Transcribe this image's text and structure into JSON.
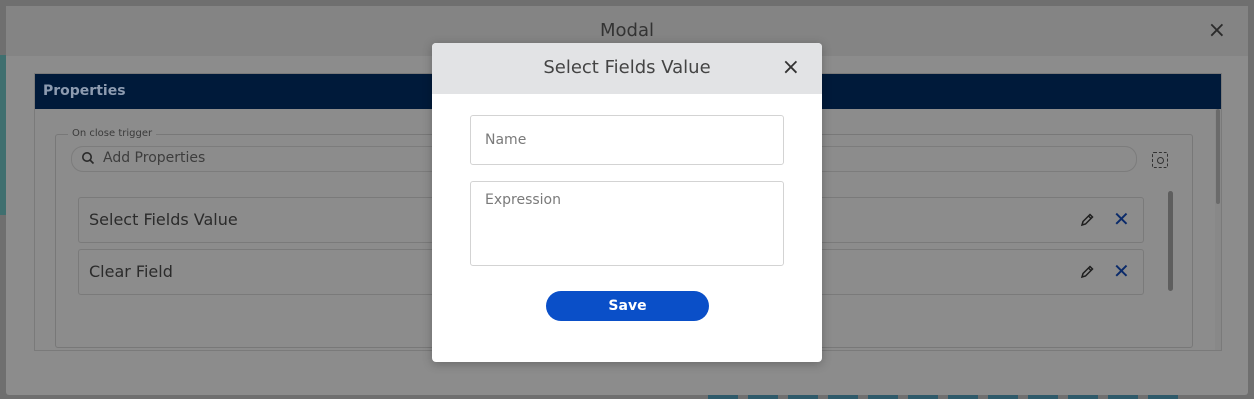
{
  "outer_modal": {
    "title": "Modal",
    "close_icon": "×"
  },
  "properties": {
    "header": "Properties",
    "trigger_legend": "On close trigger",
    "search_placeholder": "Add Properties",
    "settings_icon": "settings-icon",
    "items": [
      {
        "label": "Select Fields Value"
      },
      {
        "label": "Clear Field"
      }
    ],
    "delete_icon": "✕"
  },
  "dialog": {
    "title": "Select Fields Value",
    "close_icon": "×",
    "name_placeholder": "Name",
    "name_value": "",
    "expression_placeholder": "Expression",
    "expression_value": "",
    "save_label": "Save"
  },
  "colors": {
    "dim_overlay": "#6f6f6f",
    "properties_header": "#001a3a",
    "accent_button": "#0a4fc8",
    "dialog_header": "#e2e3e5"
  }
}
